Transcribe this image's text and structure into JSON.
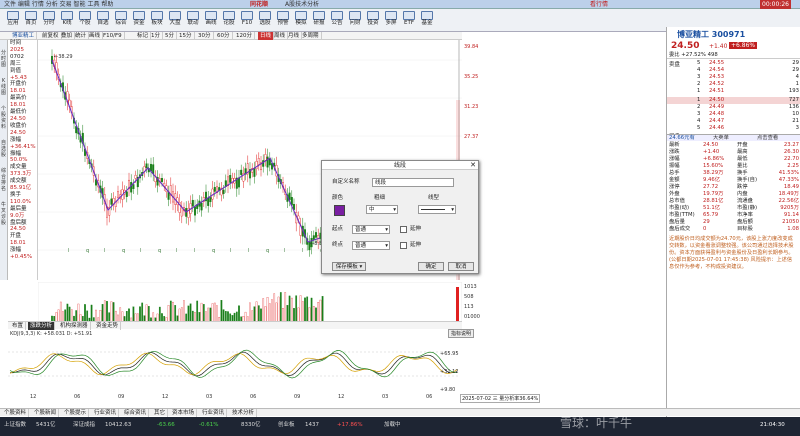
{
  "app": {
    "title": "同花顺",
    "subtitle": "A股技术分析",
    "badge": "看行情"
  },
  "toolbar": {
    "items": [
      "应用",
      "首页",
      "分时",
      "K线",
      "个股",
      "自选",
      "综合",
      "资金",
      "板块",
      "大盘",
      "联动",
      "画线",
      "论股",
      "F10",
      "选股",
      "预警",
      "模拟",
      "研报",
      "公告",
      "问财",
      "投资",
      "多屏",
      "ETF",
      "基金"
    ]
  },
  "chartbar": {
    "periods": [
      "前复权",
      "叠加",
      "统计",
      "画线",
      "F10/F9",
      "标记",
      "1分",
      "5分",
      "15分",
      "30分",
      "60分",
      "120分",
      "日线",
      "周线",
      "月线",
      "多周期"
    ],
    "stock_label": "博亚精工"
  },
  "leftinfo": {
    "lines": [
      "时间",
      "2025",
      "0702",
      "周三",
      "到值",
      "+5.43",
      "开盘价",
      "18.01",
      "最高价",
      "18.01",
      "最低价",
      "24.50",
      "收盘价",
      "24.50",
      "涨幅",
      "+36.41%",
      "振幅",
      "50.0%",
      "成交量",
      "373.3万",
      "成交额",
      "85.91亿",
      "换手",
      "110.0%",
      "最后量",
      "9.0万",
      "盘后额",
      "24.50",
      "开盘",
      "18.01",
      "涨幅",
      "+0.45%"
    ]
  },
  "sidetabs": [
    "分时图",
    "K线图",
    "个股资料",
    "自选股",
    "综合排名",
    "牛叉诊股"
  ],
  "chart": {
    "high_label": "38.29",
    "low_label": "8.8",
    "price_ticks": [
      "39.84",
      "35.25",
      "31.23",
      "27.37",
      "23.52",
      "21.10",
      "16.40",
      "11.70"
    ],
    "date_ticks": [
      "12",
      "06",
      "09",
      "12",
      "03",
      "06",
      "09",
      "12",
      "03",
      "06"
    ],
    "status": "2025-07-02  三  量分析率36.64%"
  },
  "volume": {
    "ticks": [
      "1013",
      "508",
      "113",
      "01000"
    ]
  },
  "indicator": {
    "label": "KDJ(9,3,3) K: +58.031  D: +51.91",
    "help": "指标说明",
    "ticks": [
      "+65.95",
      "+31.12",
      "+9.80"
    ]
  },
  "indicator_tabs": [
    "布置",
    "涨跌分析",
    "机构探测器",
    "资金走势"
  ],
  "dialog": {
    "title": "线段",
    "name_label": "自定义名称",
    "name_value": "线段",
    "color_label": "颜色",
    "width_label": "粗细",
    "width_value": "中",
    "type_label": "线型",
    "start_label": "起点",
    "start_value": "普通",
    "end_label": "终点",
    "end_value": "普通",
    "extend_label": "延伸",
    "save_label": "保存模板",
    "ok_label": "确定",
    "cancel_label": "取消",
    "color_hex": "#7a1fa2"
  },
  "quote": {
    "name": "博亚精工 300971",
    "price": "24.50",
    "change": "+1.40",
    "pct": "+6.86%",
    "comp_label": "委比",
    "comp_value": "+27.52%",
    "comp_diff": "498",
    "sell": [
      [
        "5",
        "24.55",
        "29"
      ],
      [
        "4",
        "24.54",
        "29"
      ],
      [
        "3",
        "24.53",
        "4"
      ],
      [
        "2",
        "24.52",
        "1"
      ],
      [
        "1",
        "24.51",
        "193"
      ]
    ],
    "buy": [
      [
        "1",
        "24.50",
        "727"
      ],
      [
        "2",
        "24.49",
        "136"
      ],
      [
        "3",
        "24.48",
        "10"
      ],
      [
        "4",
        "24.47",
        "21"
      ],
      [
        "5",
        "24.46",
        "3"
      ]
    ],
    "tabs": [
      "24.66元有",
      "大卖单",
      "点击查看"
    ],
    "stats": [
      [
        "最新",
        "24.50",
        "开盘",
        "23.27"
      ],
      [
        "涨跌",
        "+1.40",
        "最高",
        "26.30"
      ],
      [
        "涨幅",
        "+6.86%",
        "最低",
        "22.70"
      ],
      [
        "振幅",
        "15.60%",
        "量比",
        "2.25"
      ],
      [
        "总手",
        "38.29万",
        "换手",
        "41.53%"
      ],
      [
        "金额",
        "9.46亿",
        "换手(自)",
        "47.33%"
      ],
      [
        "涨停",
        "27.72",
        "跌停",
        "18.49"
      ],
      [
        "外盘",
        "19.79万",
        "内盘",
        "18.49万"
      ],
      [
        "总市值",
        "28.81亿",
        "流通盘",
        "22.56亿"
      ],
      [
        "市盈(动)",
        "51.1亿",
        "市盈(静)",
        "9205万"
      ],
      [
        "市盈(TTM)",
        "65.79",
        "市净率",
        "91.14"
      ],
      [
        "盘后量",
        "29",
        "盘后额",
        "21050"
      ],
      [
        "盘后成交",
        "0",
        "目标股",
        "1.08"
      ]
    ],
    "news": "近期股价日均成交额为24.70元，该股上涨力度改变成交转数，以资金看涨调整较强。该公司通过选择技术股份。资本方面获得盈利与资金股份及日盈利长期参与。(公都日期2025-07-01 17:45:38) 风险提示：上述信息仅作为参考，不构成投资建议。"
  },
  "bottomtabs": [
    "个股资料",
    "个股新闻",
    "个股提示",
    "行业资讯",
    "综合资讯",
    "其它",
    "资本市场",
    "行业资讯",
    "技术分析"
  ],
  "taskbar": {
    "items": [
      "上证指数",
      "5431亿",
      "深证成指",
      "10412.63",
      "-63.66",
      "-0.61%",
      "8330亿",
      "创业板",
      "1437",
      "+17.86%",
      "加载中"
    ],
    "time": "21:04:30",
    "watermark": "雪球：叶千牛"
  },
  "colors": {
    "up": "#e02020",
    "down": "#1a7f1a",
    "kline": "#6a2fbf",
    "accent": "#1a4fa0"
  }
}
